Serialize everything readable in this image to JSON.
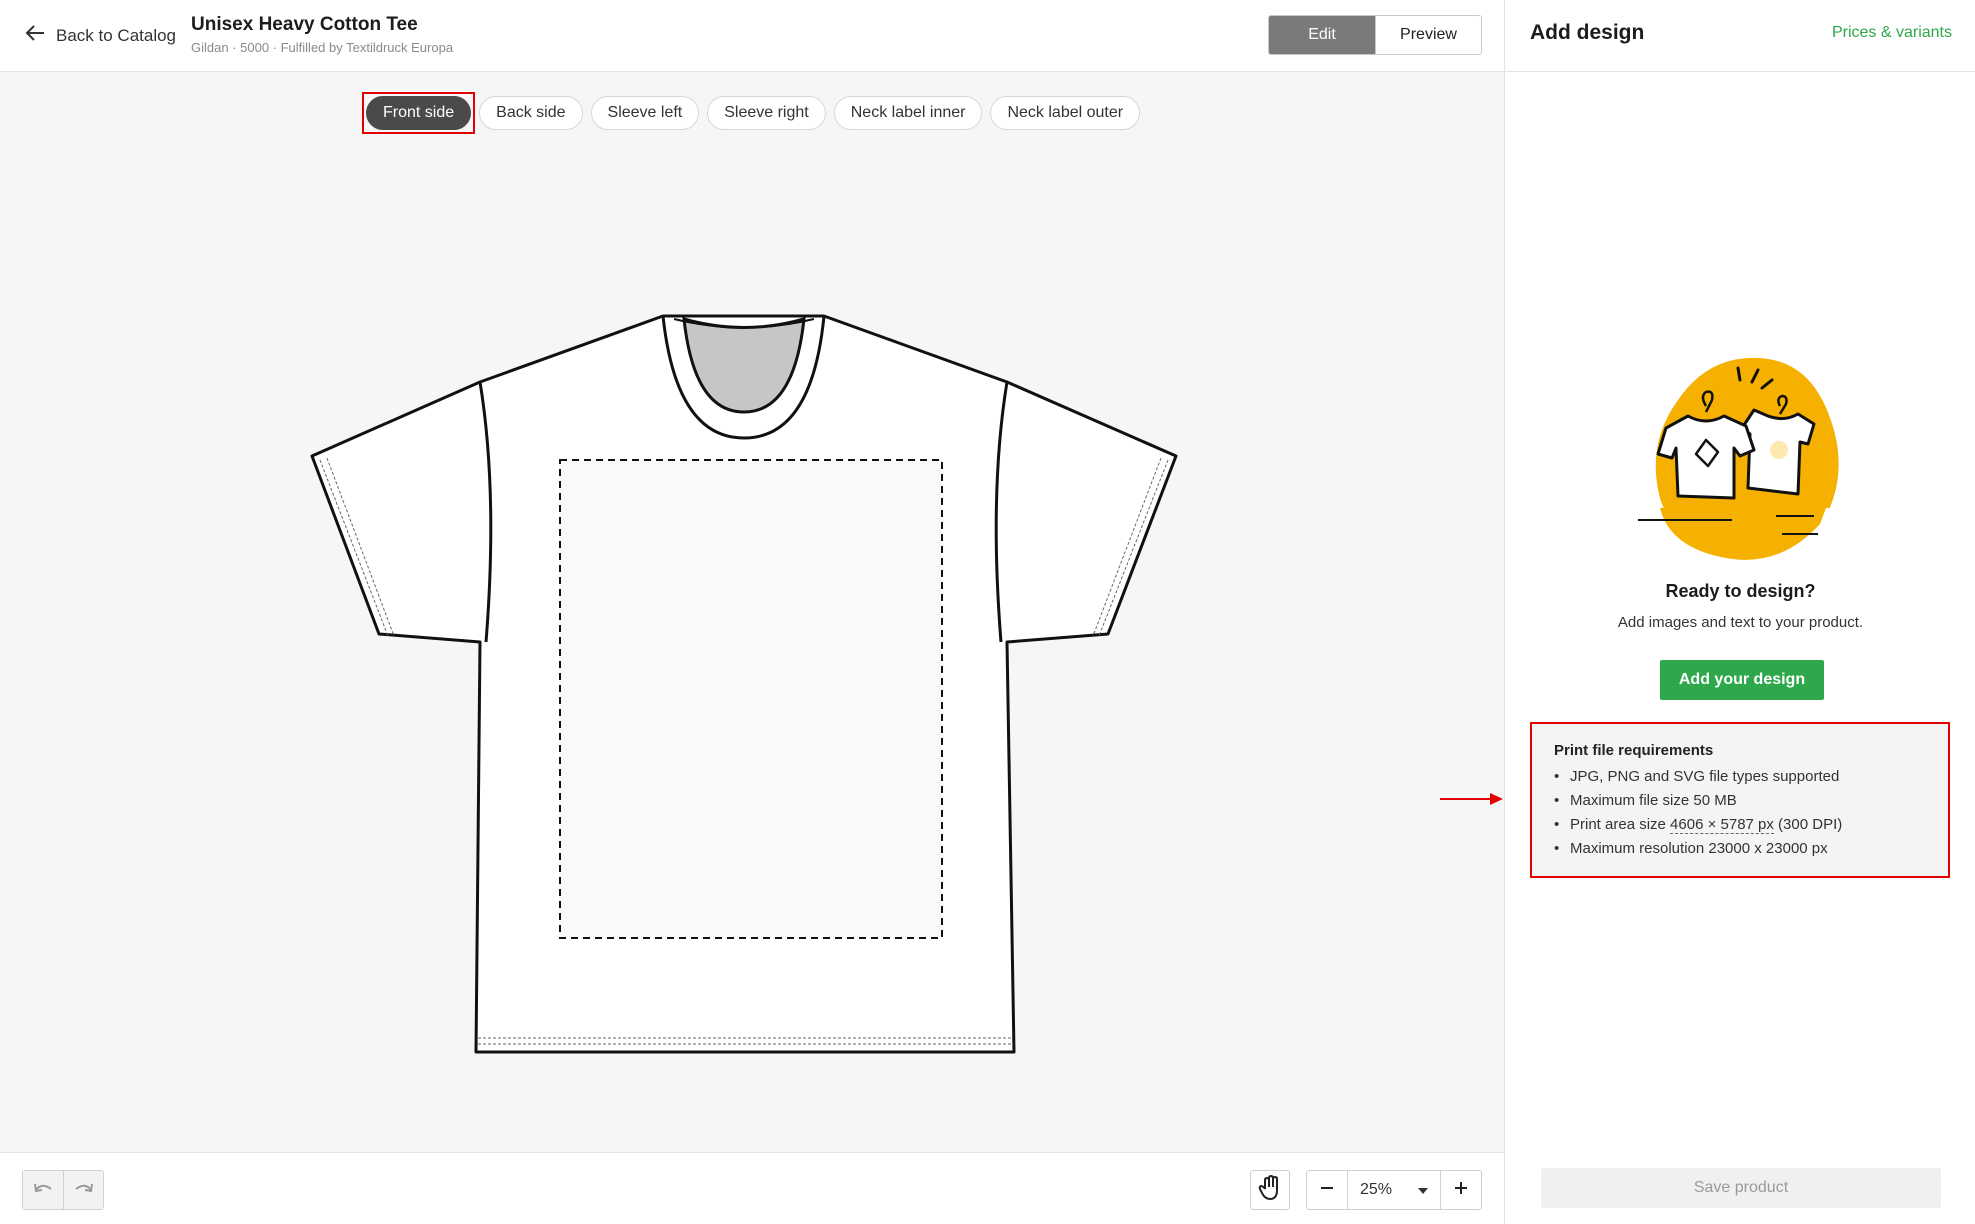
{
  "topbar": {
    "back_label": "Back to Catalog",
    "product_title": "Unisex Heavy Cotton Tee",
    "product_subtitle": "Gildan · 5000 · Fulfilled by Textildruck Europa",
    "edit_label": "Edit",
    "preview_label": "Preview"
  },
  "side_tabs": [
    {
      "label": "Front side",
      "active": true
    },
    {
      "label": "Back side",
      "active": false
    },
    {
      "label": "Sleeve left",
      "active": false
    },
    {
      "label": "Sleeve right",
      "active": false
    },
    {
      "label": "Neck label inner",
      "active": false
    },
    {
      "label": "Neck label outer",
      "active": false
    }
  ],
  "bottombar": {
    "zoom": "25%"
  },
  "panel": {
    "title": "Add design",
    "link": "Prices & variants",
    "ready_title": "Ready to design?",
    "ready_text": "Add images and text to your product.",
    "add_button": "Add your design",
    "requirements": {
      "title": "Print file requirements",
      "items": [
        "JPG, PNG and SVG file types supported",
        "Maximum file size 50 MB",
        "Maximum resolution 23000 x 23000 px"
      ],
      "print_area_prefix": "Print area size ",
      "print_area_value": "4606 × 5787 px",
      "print_area_suffix": " (300 DPI)"
    },
    "save_button": "Save product"
  },
  "colors": {
    "accent_green": "#2ea84a",
    "illustration_yellow": "#f6b000",
    "annotation_red": "#e30000"
  }
}
